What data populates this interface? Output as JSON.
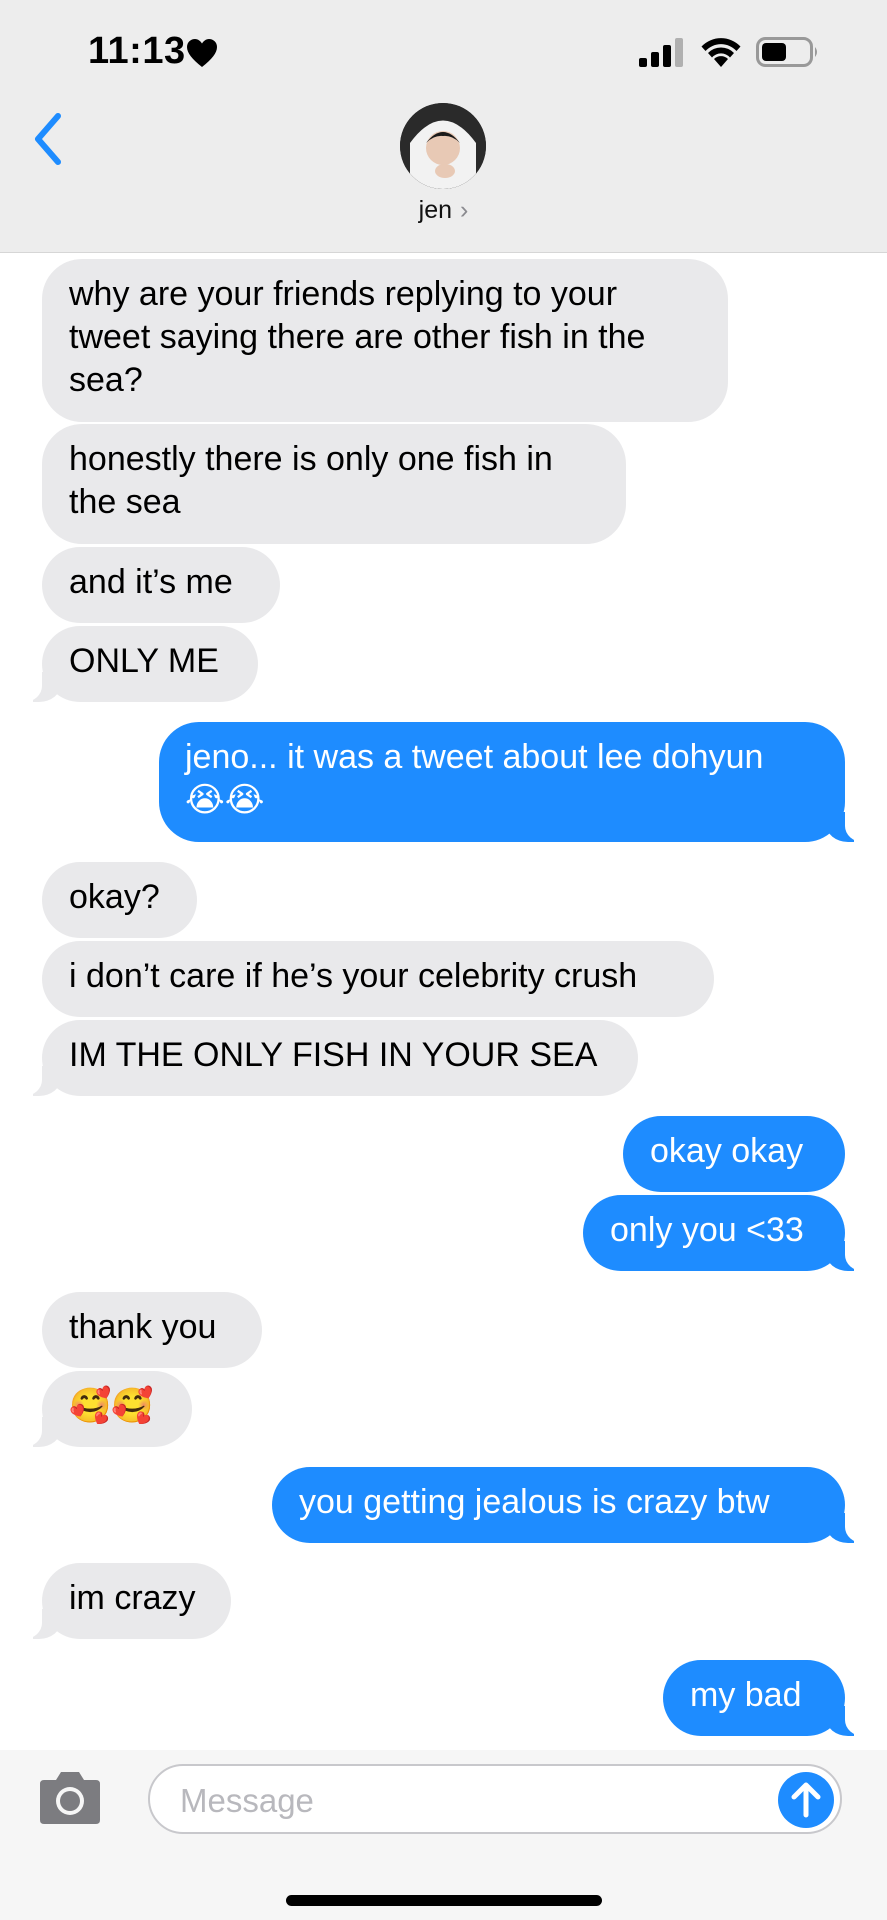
{
  "status_bar": {
    "time": "11:13",
    "time_icon": "heart-icon",
    "icons": [
      "signal-icon",
      "wifi-icon",
      "battery-icon"
    ]
  },
  "header": {
    "back_icon": "chevron-left-icon",
    "contact_name": "jen",
    "chevron": "›",
    "avatar": "avatar"
  },
  "messages": [
    {
      "from": "them",
      "text": "why are your friends replying to your\ntweet saying there are other fish in the\nsea?"
    },
    {
      "from": "them",
      "text": "honestly there is only one fish in\nthe sea"
    },
    {
      "from": "them",
      "text": "and it’s me"
    },
    {
      "from": "them",
      "text": "ONLY ME"
    },
    {
      "from": "me",
      "text": "jeno... it was a tweet about lee dohyun\n😭😭"
    },
    {
      "from": "them",
      "text": "okay?"
    },
    {
      "from": "them",
      "text": "i don’t care if he’s your celebrity crush"
    },
    {
      "from": "them",
      "text": "IM THE ONLY FISH IN YOUR SEA"
    },
    {
      "from": "me",
      "text": "okay okay"
    },
    {
      "from": "me",
      "text": "only you <33"
    },
    {
      "from": "them",
      "text": "thank you"
    },
    {
      "from": "them",
      "text": "🥰🥰"
    },
    {
      "from": "me",
      "text": "you getting jealous is crazy btw"
    },
    {
      "from": "them",
      "text": "im crazy"
    },
    {
      "from": "me",
      "text": "my bad"
    }
  ],
  "input": {
    "placeholder": "Message",
    "camera_icon": "camera-icon",
    "send_icon": "arrow-up-icon"
  },
  "colors": {
    "sent_bubble": "#1e8cff",
    "received_bubble": "#e9e9eb",
    "accent": "#1e8cff"
  }
}
